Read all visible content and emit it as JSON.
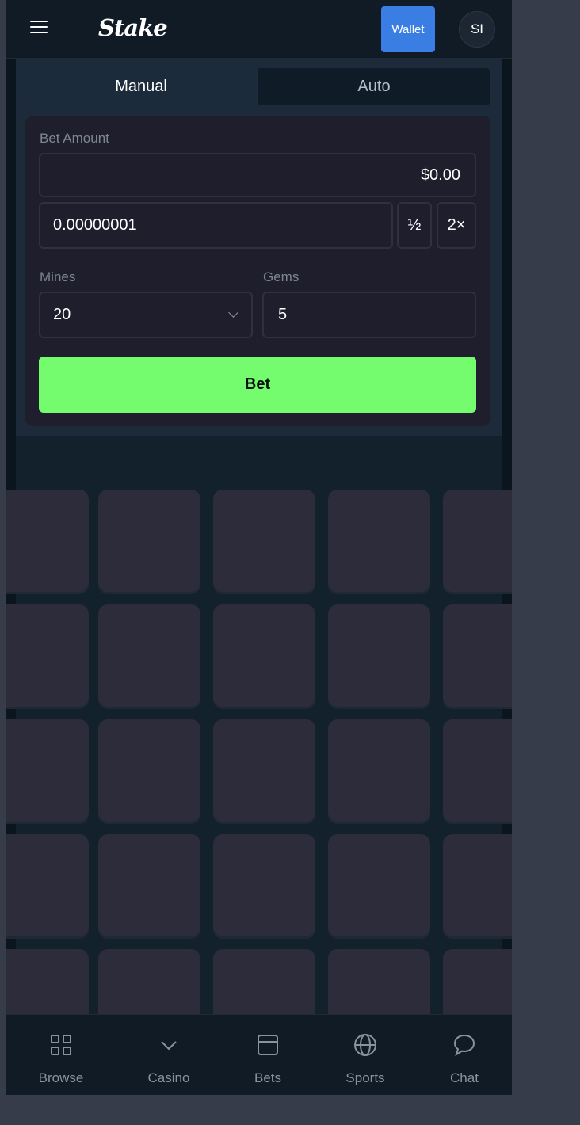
{
  "header": {
    "logo": "Stake",
    "wallet_label": "Wallet",
    "avatar_initials": "SI"
  },
  "tabs": [
    {
      "label": "Manual",
      "active": true
    },
    {
      "label": "Auto",
      "active": false
    }
  ],
  "bet_form": {
    "bet_amount_label": "Bet Amount",
    "usd_value": "$0.00",
    "crypto_value": "0.00000001",
    "half_label": "½",
    "double_label": "2×",
    "mines_label": "Mines",
    "mines_value": "20",
    "gems_label": "Gems",
    "gems_value": "5",
    "bet_button": "Bet"
  },
  "bottom_nav": [
    {
      "label": "Browse",
      "icon": "grid-icon"
    },
    {
      "label": "Casino",
      "icon": "chevron-down-icon"
    },
    {
      "label": "Bets",
      "icon": "bets-icon"
    },
    {
      "label": "Sports",
      "icon": "globe-icon"
    },
    {
      "label": "Chat",
      "icon": "chat-bubble-icon"
    }
  ],
  "colors": {
    "accent_green": "#74fb6e",
    "wallet_blue": "#3a7ee4",
    "background": "#0f1b25",
    "tile": "#2d2c3b"
  }
}
